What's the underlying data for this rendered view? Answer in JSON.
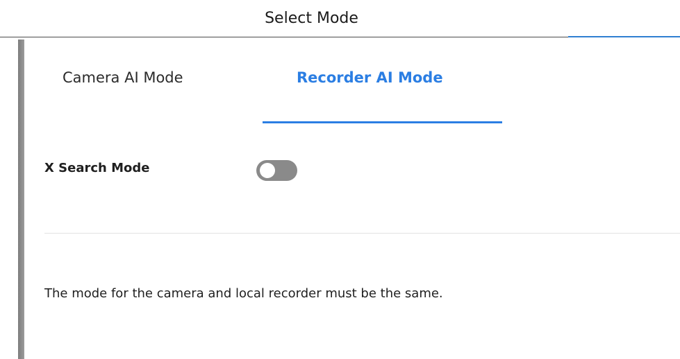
{
  "dialog": {
    "title": "Select Mode"
  },
  "tabs": [
    {
      "label": "Camera AI Mode",
      "active": false
    },
    {
      "label": "Recorder AI Mode",
      "active": true
    }
  ],
  "settings": {
    "x_search_mode": {
      "label": "X Search Mode",
      "enabled": false
    }
  },
  "notice": "The mode for the camera and local recorder must be the same.",
  "colors": {
    "accent": "#2b7ee3",
    "toggle_off": "#8a8a8a",
    "text": "#1f1f1f"
  }
}
